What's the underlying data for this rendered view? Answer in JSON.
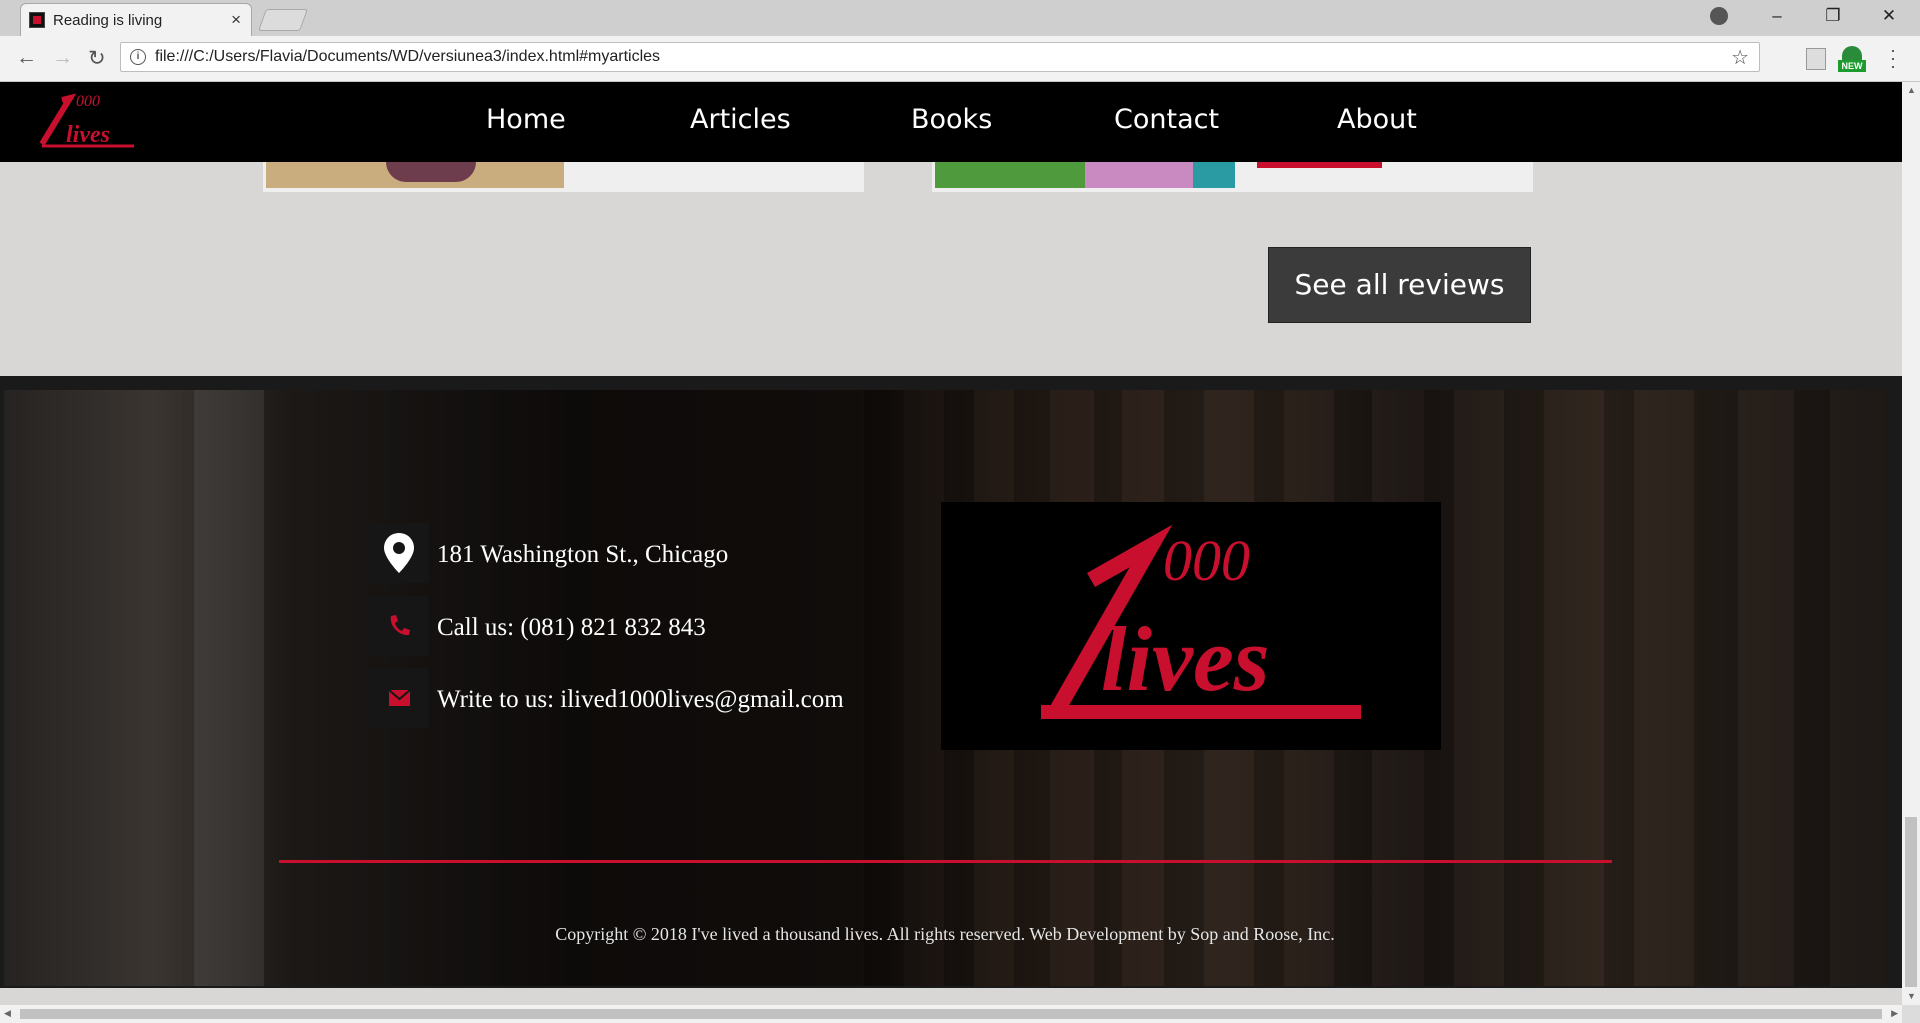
{
  "browser": {
    "tab_title": "Reading is living",
    "tab_close": "×",
    "url": "file:///C:/Users/Flavia/Documents/WD/versiunea3/index.html#myarticles",
    "extension_badge": "NEW",
    "window_controls": {
      "minimize": "–",
      "restore": "❐",
      "close": "✕"
    },
    "nav": {
      "back": "←",
      "forward": "→",
      "reload": "↻",
      "star": "☆"
    }
  },
  "site_nav": {
    "items": [
      {
        "label": "Home"
      },
      {
        "label": "Articles"
      },
      {
        "label": "Books"
      },
      {
        "label": "Contact"
      },
      {
        "label": "About"
      }
    ]
  },
  "logo": {
    "text_top": "000",
    "text_bottom": "lives",
    "color": "#c8102e"
  },
  "reviews": {
    "see_all_label": "See all reviews"
  },
  "footer": {
    "contacts": [
      {
        "icon": "map-pin-icon",
        "text": "181 Washington St., Chicago"
      },
      {
        "icon": "phone-icon",
        "text": "Call us: (081) 821 832 843"
      },
      {
        "icon": "envelope-icon",
        "text": "Write to us: ilived1000lives@gmail.com"
      }
    ],
    "copyright": "Copyright © 2018 I've lived a thousand lives. All rights reserved. Web Development by Sop and Roose, Inc."
  },
  "colors": {
    "accent": "#c8102e",
    "nav_bg": "#000000",
    "page_bg": "#d9d7d6",
    "button_bg": "#3b3b3b"
  }
}
